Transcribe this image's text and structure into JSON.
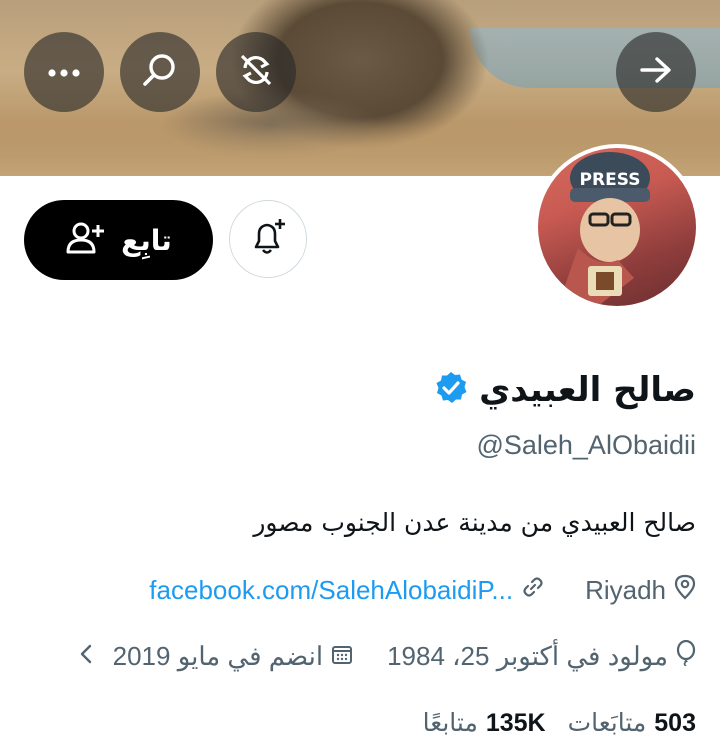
{
  "profile": {
    "name": "صالح العبيدي",
    "handle": "@Saleh_AlObaidii",
    "bio": "صالح العبيدي من مدينة عدن الجنوب مصور",
    "location": "Riyadh",
    "link": "facebook.com/SalehAlobaidiP...",
    "birthday": "مولود في أكتوبر 25، 1984",
    "joined": "انضم في مايو 2019",
    "avatar_text": "PRESS"
  },
  "actions": {
    "follow_label": "تابِع"
  },
  "stats": {
    "following_count": "503",
    "following_label": "متابَعات",
    "followers_count": "135K",
    "followers_label": "متابعًا"
  },
  "icons": {
    "more": "more-dots-icon",
    "search": "search-icon",
    "block": "no-retweet-icon",
    "forward": "arrow-right-icon",
    "verified": "verified-badge-icon",
    "bell": "bell-plus-icon",
    "follow": "person-plus-icon",
    "location": "location-pin-icon",
    "link": "link-icon",
    "birthday": "balloon-icon",
    "calendar": "calendar-icon",
    "chevron": "chevron-left-icon"
  },
  "colors": {
    "accent": "#1d9bf0",
    "verified": "#1d9bf0",
    "text": "#0f1419",
    "muted": "#536471"
  }
}
